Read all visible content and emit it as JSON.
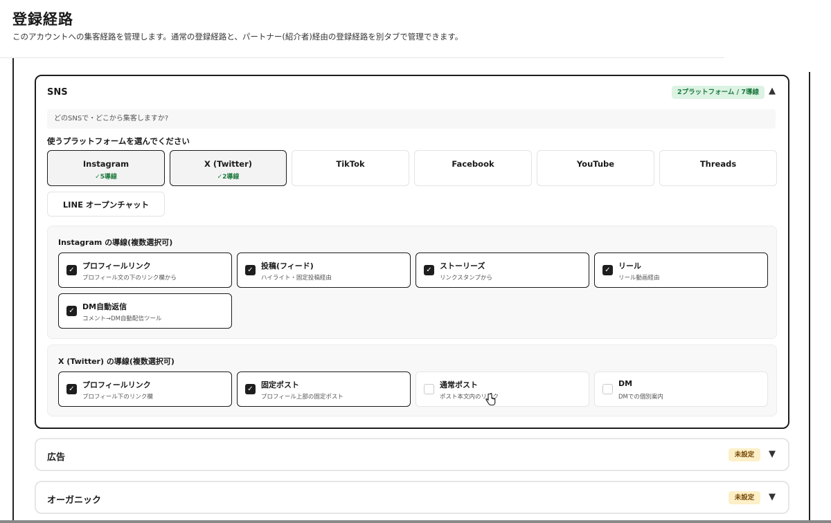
{
  "page": {
    "title": "登録経路",
    "description": "このアカウントへの集客経路を管理します。通常の登録経路と、パートナー(紹介者)経由の登録経路を別タブで管理できます。"
  },
  "sns": {
    "title": "SNS",
    "badge": "2プラットフォーム / 7導線",
    "caret": "▲",
    "hint": "どのSNSで・どこから集客しますか?",
    "choose_label": "使うプラットフォームを選んでください",
    "platforms": [
      {
        "name": "Instagram",
        "count": "✓5導線",
        "selected": true
      },
      {
        "name": "X (Twitter)",
        "count": "✓2導線",
        "selected": true
      },
      {
        "name": "TikTok",
        "count": "",
        "selected": false
      },
      {
        "name": "Facebook",
        "count": "",
        "selected": false
      },
      {
        "name": "YouTube",
        "count": "",
        "selected": false
      },
      {
        "name": "Threads",
        "count": "",
        "selected": false
      },
      {
        "name": "LINE オープンチャット",
        "count": "",
        "selected": false
      }
    ],
    "instagram_panel": {
      "title": "Instagram の導線(複数選択可)",
      "options": [
        {
          "title": "プロフィールリンク",
          "sub": "プロフィール文の下のリンク欄から",
          "checked": true
        },
        {
          "title": "投稿(フィード)",
          "sub": "ハイライト・固定投稿経由",
          "checked": true
        },
        {
          "title": "ストーリーズ",
          "sub": "リンクスタンプから",
          "checked": true
        },
        {
          "title": "リール",
          "sub": "リール動画経由",
          "checked": true
        },
        {
          "title": "DM自動返信",
          "sub": "コメント→DM自動配信ツール",
          "checked": true
        }
      ]
    },
    "x_panel": {
      "title": "X (Twitter) の導線(複数選択可)",
      "options": [
        {
          "title": "プロフィールリンク",
          "sub": "プロフィール下のリンク欄",
          "checked": true
        },
        {
          "title": "固定ポスト",
          "sub": "プロフィール上部の固定ポスト",
          "checked": true
        },
        {
          "title": "通常ポスト",
          "sub": "ポスト本文内のリンク",
          "checked": false
        },
        {
          "title": "DM",
          "sub": "DMでの個別案内",
          "checked": false
        }
      ]
    }
  },
  "ads": {
    "title": "広告",
    "badge": "未設定",
    "caret": "▼"
  },
  "organic": {
    "title": "オーガニック",
    "badge": "未設定",
    "caret": "▼"
  },
  "checkmark": "✓",
  "colors": {
    "accent_green": "#1f7a40",
    "badge_green_bg": "#dcf3e4",
    "badge_yellow_bg": "#fdf0c8",
    "selected_border": "#1a1a1a"
  }
}
